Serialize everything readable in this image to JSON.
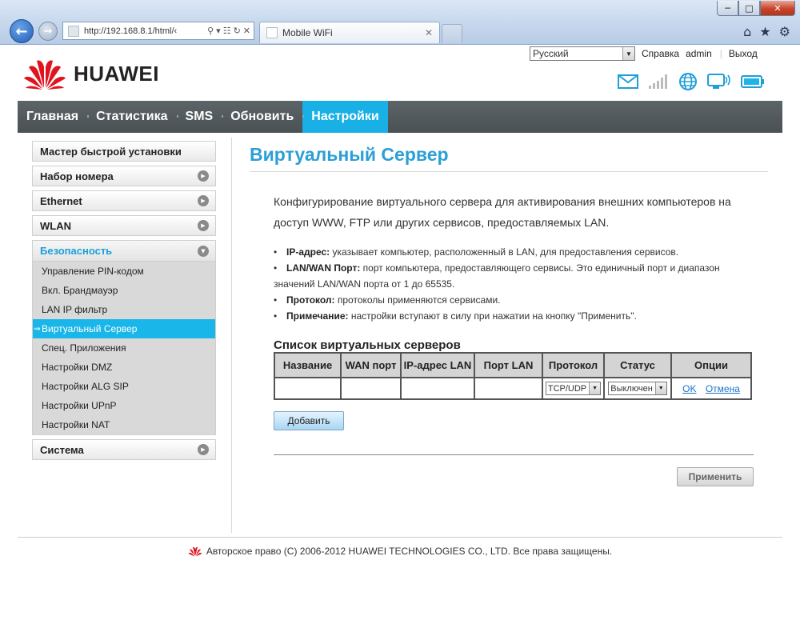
{
  "browser": {
    "address": "http://192.168.8.1/html/‹",
    "tab_title": "Mobile WiFi",
    "tab_close": "✕",
    "window_controls": [
      "minimize",
      "maximize",
      "close"
    ],
    "toolbar_icons": [
      "home-icon",
      "star-icon",
      "gear-icon"
    ]
  },
  "header": {
    "language": "Русский",
    "help": "Справка",
    "user": "admin",
    "separator": "|",
    "logout": "Выход",
    "brand": "HUAWEI",
    "status_icons": [
      "mail-icon",
      "signal-icon",
      "globe-icon",
      "wifi-display-icon",
      "battery-icon"
    ]
  },
  "nav": {
    "items": [
      "Главная",
      "Статистика",
      "SMS",
      "Обновить",
      "Настройки"
    ],
    "active": "Настройки"
  },
  "sidebar": {
    "items": [
      {
        "label": "Мастер быстрой установки"
      },
      {
        "label": "Набор номера"
      },
      {
        "label": "Ethernet"
      },
      {
        "label": "WLAN"
      }
    ],
    "group": {
      "label": "Безопасность",
      "items": [
        "Управление PIN-кодом",
        "Вкл. Брандмауэр",
        "LAN IP фильтр",
        "Виртуальный Сервер",
        "Спец. Приложения",
        "Настройки DMZ",
        "Настройки ALG SIP",
        "Настройки UPnP",
        "Настройки NAT"
      ],
      "active": "Виртуальный Сервер",
      "active_marker": "⇒"
    },
    "last": {
      "label": "Система"
    }
  },
  "content": {
    "title": "Виртуальный Сервер",
    "intro": "Конфигурирование виртуального сервера для активирования внешних компьютеров на доступ WWW, FTP или других сервисов, предоставляемых LAN.",
    "bullets": [
      {
        "term": "IP-адрес:",
        "text": " указывает компьютер, расположенный в LAN, для предоставления сервисов."
      },
      {
        "term": "LAN/WAN Порт:",
        "text": " порт компьютера, предоставляющего сервисы. Это единичный порт и диапазон значений LAN/WAN порта от 1 до 65535."
      },
      {
        "term": "Протокол:",
        "text": " протоколы применяются сервисами."
      },
      {
        "term": "Примечание:",
        "text": " настройки вступают в силу при нажатии на кнопку \"Применить\"."
      }
    ],
    "bullet_char": "•",
    "list_title": "Список виртуальных серверов",
    "table": {
      "headers": [
        "Название",
        "WAN порт",
        "IP-адрес LAN",
        "Порт LAN",
        "Протокол",
        "Статус",
        "Опции"
      ],
      "row": {
        "name": "",
        "wan_port": "",
        "ip": "",
        "lan_port": "",
        "protocol": "TCP/UDP",
        "status": "Выключен",
        "ok": "OK",
        "cancel": "Отмена"
      }
    },
    "add_button": "Добавить",
    "apply_button": "Применить"
  },
  "footer": {
    "copyright": "Авторское право (C) 2006-2012 HUAWEI TECHNOLOGIES CO., LTD. Все права защищены."
  },
  "colors": {
    "accent": "#19b0e6",
    "title": "#2b9fd6",
    "nav_bg": "#52595d",
    "brand_red": "#e0141e"
  }
}
